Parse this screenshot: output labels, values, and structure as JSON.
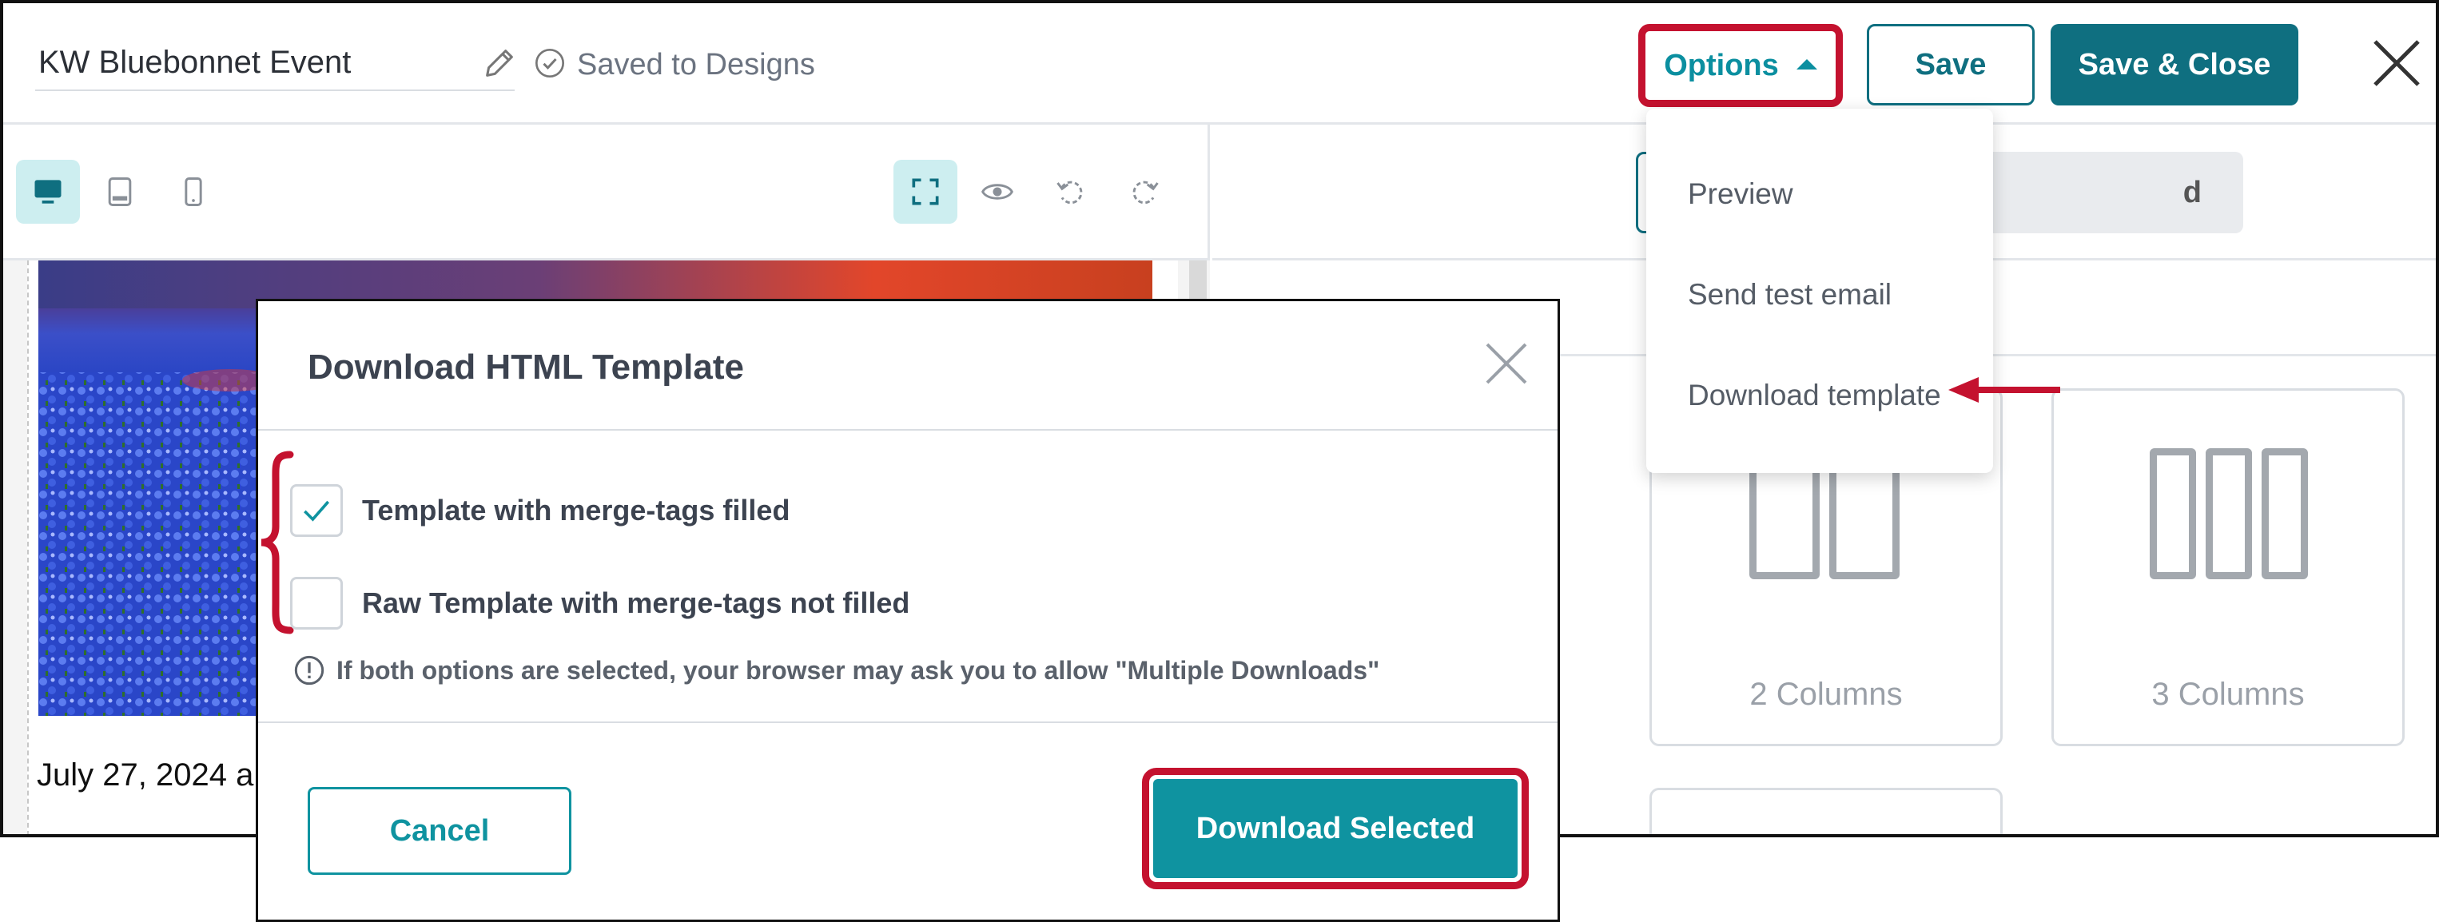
{
  "header": {
    "design_name": "KW Bluebonnet Event",
    "saved_status": "Saved to Designs",
    "options_label": "Options",
    "save_label": "Save",
    "save_close_label": "Save & Close"
  },
  "options_menu": {
    "items": [
      "Preview",
      "Send test email",
      "Download template"
    ]
  },
  "editor": {
    "event_date_text": "July 27, 2024 a"
  },
  "right_panel": {
    "tab_partial_label": "d",
    "blocks": [
      "2 Columns",
      "3 Columns"
    ]
  },
  "modal": {
    "title": "Download HTML Template",
    "options": [
      {
        "label": "Template with merge-tags filled",
        "checked": true
      },
      {
        "label": "Raw Template with merge-tags not filled",
        "checked": false
      }
    ],
    "info_text": "If both options are selected, your browser may ask you to allow \"Multiple Downloads\"",
    "cancel_label": "Cancel",
    "download_label": "Download Selected"
  },
  "colors": {
    "accent_teal": "#0f93a0",
    "brand_dark_teal": "#0f6f80",
    "annotation_red": "#c4122f"
  },
  "icons": [
    "pencil-icon",
    "check-circle-icon",
    "close-icon",
    "desktop-icon",
    "tablet-icon",
    "mobile-icon",
    "fullscreen-icon",
    "eye-icon",
    "undo-icon",
    "redo-icon",
    "checkmark-icon",
    "info-icon"
  ]
}
